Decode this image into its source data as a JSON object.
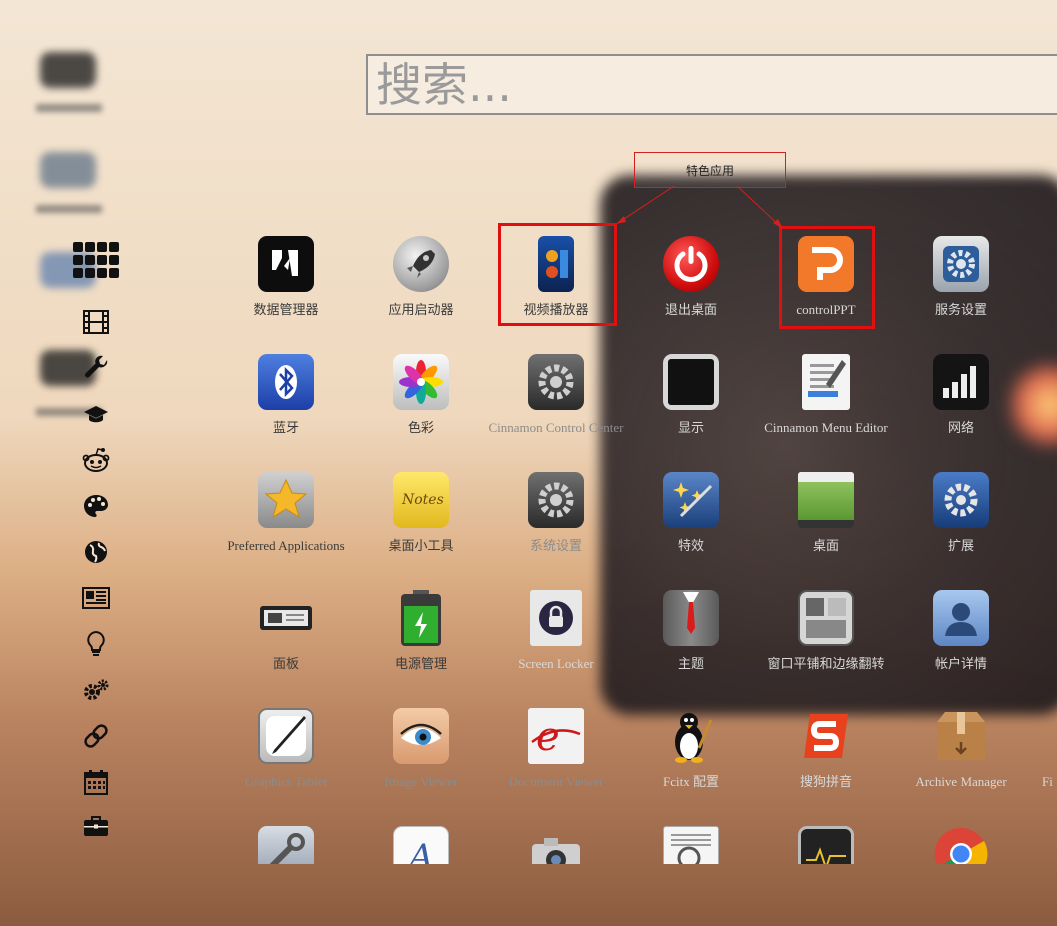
{
  "search": {
    "placeholder": "搜索..."
  },
  "annotation": {
    "label": "特色应用"
  },
  "sidebar": {
    "items": [
      {
        "name": "all-apps-icon"
      },
      {
        "name": "film-icon"
      },
      {
        "name": "wrench-icon"
      },
      {
        "name": "graduation-cap-icon"
      },
      {
        "name": "reddit-alien-icon"
      },
      {
        "name": "palette-icon"
      },
      {
        "name": "globe-icon"
      },
      {
        "name": "newspaper-icon"
      },
      {
        "name": "lightbulb-icon"
      },
      {
        "name": "gears-icon"
      },
      {
        "name": "link-icon"
      },
      {
        "name": "calendar-icon"
      },
      {
        "name": "briefcase-icon"
      }
    ]
  },
  "apps": [
    {
      "label": "数据管理器",
      "icon": "data-manager-icon"
    },
    {
      "label": "应用启动器",
      "icon": "rocket-icon"
    },
    {
      "label": "视频播放器",
      "icon": "video-player-icon"
    },
    {
      "label": "退出桌面",
      "icon": "power-icon"
    },
    {
      "label": "controlPPT",
      "icon": "control-ppt-icon"
    },
    {
      "label": "服务设置",
      "icon": "service-settings-icon"
    },
    {
      "label": "蓝牙",
      "icon": "bluetooth-icon"
    },
    {
      "label": "色彩",
      "icon": "color-flower-icon"
    },
    {
      "label": "Cinnamon Control Center",
      "icon": "gear-icon"
    },
    {
      "label": "显示",
      "icon": "display-icon"
    },
    {
      "label": "Cinnamon Menu Editor",
      "icon": "menu-editor-icon"
    },
    {
      "label": "网络",
      "icon": "network-bars-icon"
    },
    {
      "label": "Preferred Applications",
      "icon": "star-icon"
    },
    {
      "label": "桌面小工具",
      "icon": "notes-icon"
    },
    {
      "label": "系统设置",
      "icon": "gear-icon"
    },
    {
      "label": "特效",
      "icon": "effects-icon"
    },
    {
      "label": "桌面",
      "icon": "desktop-icon"
    },
    {
      "label": "扩展",
      "icon": "extension-gear-icon"
    },
    {
      "label": "面板",
      "icon": "panel-icon"
    },
    {
      "label": "电源管理",
      "icon": "battery-icon"
    },
    {
      "label": "Screen Locker",
      "icon": "lock-icon"
    },
    {
      "label": "主题",
      "icon": "suit-icon"
    },
    {
      "label": "窗口平铺和边缘翻转",
      "icon": "window-tiling-icon"
    },
    {
      "label": "帐户详情",
      "icon": "user-icon"
    },
    {
      "label": "Graphics Tablet",
      "icon": "tablet-pen-icon"
    },
    {
      "label": "Image Viewer",
      "icon": "eye-icon"
    },
    {
      "label": "Document Viewer",
      "icon": "document-viewer-icon"
    },
    {
      "label": "Fcitx 配置",
      "icon": "penguin-icon"
    },
    {
      "label": "搜狗拼音",
      "icon": "sogou-icon"
    },
    {
      "label": "Archive Manager",
      "icon": "archive-box-icon"
    },
    {
      "label": "Fi",
      "icon": "partial-app-icon"
    },
    {
      "label": "",
      "icon": "tools-icon"
    },
    {
      "label": "",
      "icon": "font-icon"
    },
    {
      "label": "",
      "icon": "camera-icon"
    },
    {
      "label": "",
      "icon": "search-doc-icon"
    },
    {
      "label": "",
      "icon": "system-monitor-icon"
    },
    {
      "label": "",
      "icon": "chrome-icon"
    }
  ]
}
